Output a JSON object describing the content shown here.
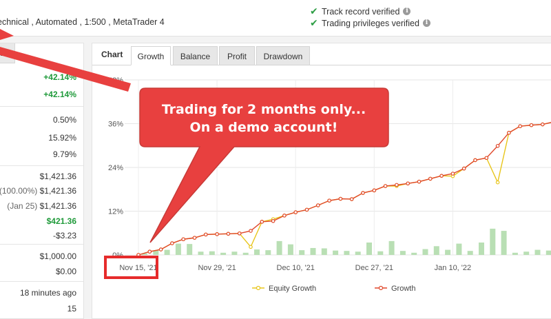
{
  "header": {
    "account_description": "echnical , Automated , 1:500 , MetaTrader 4",
    "verifications": [
      {
        "label": "Track record verified"
      },
      {
        "label": "Trading privileges verified"
      }
    ]
  },
  "left_panel": {
    "tab_label": "ral",
    "stats": [
      {
        "value": "+42.14%",
        "green": true
      },
      {
        "value": "+42.14%",
        "green": true
      },
      {
        "value": "0.50%"
      },
      {
        "value": "15.92%"
      },
      {
        "value": "9.79%"
      },
      {
        "value": "$1,421.36"
      },
      {
        "prefix": "(100.00%)",
        "value": "$1,421.36"
      },
      {
        "prefix": "(Jan 25)",
        "value": "$1,421.36"
      },
      {
        "value": "$421.36",
        "green": true
      },
      {
        "value": "-$3.23"
      },
      {
        "value": "$1,000.00"
      },
      {
        "value": "$0.00"
      },
      {
        "value": "18 minutes ago"
      },
      {
        "value": "15"
      }
    ]
  },
  "chart_panel": {
    "section_label": "Chart",
    "tabs": [
      {
        "label": "Growth",
        "active": true
      },
      {
        "label": "Balance"
      },
      {
        "label": "Profit"
      },
      {
        "label": "Drawdown"
      }
    ]
  },
  "annotation": {
    "line1": "Trading for 2 months only...",
    "line2": "On a demo account!",
    "color": "#e8403f"
  },
  "chart_data": {
    "type": "line",
    "ylim": [
      0,
      48
    ],
    "yticks": [
      {
        "v": 0,
        "label": "0%"
      },
      {
        "v": 12,
        "label": "12%"
      },
      {
        "v": 24,
        "label": "24%"
      },
      {
        "v": 36,
        "label": "36%"
      },
      {
        "v": 48,
        "label": "48%"
      }
    ],
    "x_labels": [
      {
        "i": 0,
        "label": "Nov 15, '21"
      },
      {
        "i": 7,
        "label": "Nov 29, '21"
      },
      {
        "i": 14,
        "label": "Dec 10, '21"
      },
      {
        "i": 21,
        "label": "Dec 27, '21"
      },
      {
        "i": 28,
        "label": "Jan 10, '22"
      }
    ],
    "series": [
      {
        "name": "Equity Growth",
        "color": "#e8c51a",
        "values": [
          0,
          0.9,
          1.5,
          3.2,
          4.3,
          4.7,
          5.6,
          5.7,
          5.8,
          5.9,
          2.2,
          9.1,
          9.8,
          10.8,
          11.7,
          12.4,
          13.6,
          14.9,
          15.4,
          15.3,
          17,
          17.7,
          18.9,
          18.9,
          19.6,
          20.1,
          20.9,
          21.7,
          21.6,
          23.7,
          26,
          26.6,
          19.9,
          33.5,
          35.3,
          35.6,
          35.8,
          36.5,
          37.2,
          38
        ]
      },
      {
        "name": "Growth",
        "color": "#e0472a",
        "values": [
          0,
          0.9,
          1.5,
          3.2,
          4.3,
          4.7,
          5.6,
          5.7,
          5.8,
          5.9,
          6.6,
          9.1,
          9.3,
          10.8,
          11.7,
          12.4,
          13.6,
          14.9,
          15.4,
          15.3,
          17,
          17.7,
          18.9,
          19.2,
          19.6,
          20.1,
          20.9,
          21.7,
          22.3,
          23.7,
          26,
          26.6,
          29.9,
          33.5,
          35.3,
          35.6,
          35.8,
          36.5,
          37.2,
          38
        ]
      }
    ],
    "bars": {
      "color": "#b9dfb4",
      "values": [
        0.4,
        1.2,
        1.4,
        3.1,
        3,
        0.9,
        1,
        0.6,
        0.9,
        0.6,
        1.5,
        1.3,
        3.8,
        2.9,
        1.3,
        1.9,
        1.8,
        1.2,
        1.1,
        0.9,
        3.4,
        1,
        3.8,
        1.1,
        0.6,
        1.6,
        2.4,
        1.4,
        3.1,
        1.1,
        3.4,
        7.2,
        6.6,
        0.6,
        0.9,
        1.4,
        1.2,
        0.7,
        1.3,
        3.4
      ]
    }
  }
}
